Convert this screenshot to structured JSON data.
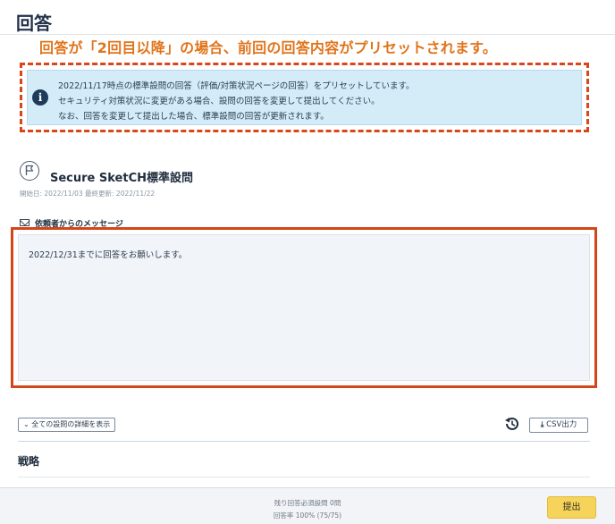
{
  "header": {
    "title": "回答"
  },
  "annotations": {
    "preset_note": "回答が「2回目以降」の場合、前回の回答内容がプリセットされます。"
  },
  "notice": {
    "lines": [
      "2022/11/17時点の標準設問の回答（評価/対策状況ページの回答）をプリセットしています。",
      "セキュリティ対策状況に変更がある場合、設問の回答を変更して提出してください。",
      "なお、回答を変更して提出した場合、標準設問の回答が更新されます。"
    ]
  },
  "questionnaire": {
    "title": "Secure SketCH標準設問",
    "dates": "開始日: 2022/11/03 最終更新: 2022/11/22"
  },
  "message": {
    "label": "依頼者からのメッセージ",
    "body": "2022/12/31までに回答をお願いします。"
  },
  "toolbar": {
    "show_details_label": "全ての設問の詳細を表示",
    "csv_label": "CSV出力"
  },
  "section": {
    "heading": "戦略"
  },
  "footer": {
    "remaining": "残り回答必須設問 0問",
    "rate": "回答率 100% (75/75)",
    "submit_label": "提出"
  },
  "colors": {
    "annotation_text": "#e0741a",
    "annotation_frame": "#d3461a",
    "notice_bg": "#d3ecf8",
    "submit_bg": "#f6d35a"
  }
}
